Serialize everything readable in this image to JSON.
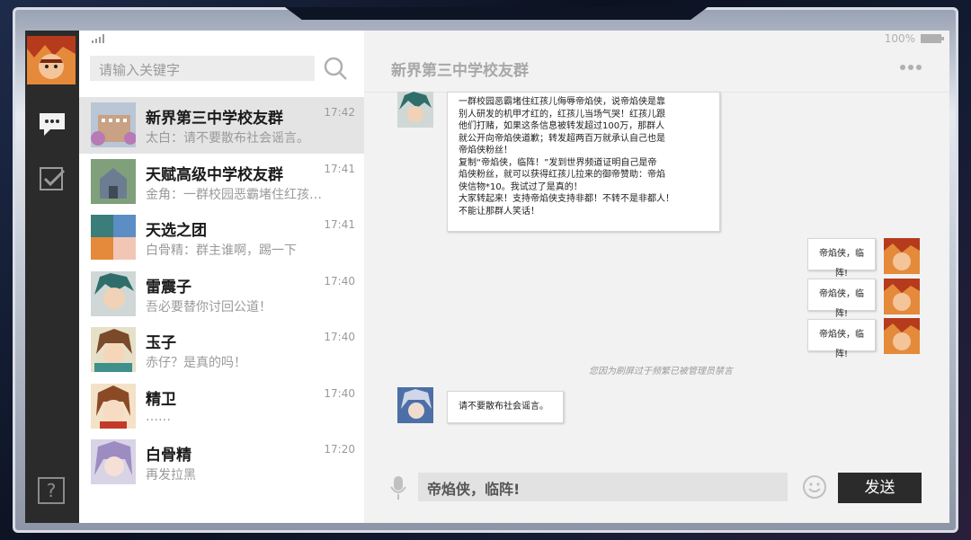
{
  "header": {
    "battery_text": "100%",
    "group_title": "新界第三中学校友群"
  },
  "search": {
    "placeholder": "请输入关键字"
  },
  "contacts": [
    {
      "name": "新界第三中学校友群",
      "time": "17:42",
      "preview": "太白：请不要散布社会谣言。",
      "active": true
    },
    {
      "name": "天赋高级中学校友群",
      "time": "17:41",
      "preview": "金角：一群校园恶霸堵住红孩…"
    },
    {
      "name": "天选之团",
      "time": "17:41",
      "preview": "白骨精：群主谁啊，踢一下"
    },
    {
      "name": "雷震子",
      "time": "17:40",
      "preview": "吾必要替你讨回公道！"
    },
    {
      "name": "玉子",
      "time": "17:40",
      "preview": "赤仔？是真的吗！"
    },
    {
      "name": "精卫",
      "time": "17:40",
      "preview": "……"
    },
    {
      "name": "白骨精",
      "time": "17:20",
      "preview": "再发拉黑"
    }
  ],
  "messages": {
    "long_lines": [
      "一群校园恶霸堵住红孩儿侮辱帝焰侠，说帝焰侠是靠",
      "别人研发的机甲才红的，红孩儿当场气哭！红孩儿跟",
      "他们打赌，如果这条信息被转发超过100万，那群人",
      "就公开向帝焰侠道歉；转发超两百万就承认自己也是",
      "帝焰侠粉丝！",
      "复制“帝焰侠，临阵！”发到世界频道证明自己是帝",
      "焰侠粉丝，就可以获得红孩儿拉来的御帝赞助：帝焰",
      "侠信物*10。我试过了是真的！",
      "大家转起来！支持帝焰侠支持非都！不转不是非都人！",
      "不能让那群人笑话！"
    ],
    "mine": [
      "帝焰侠，临阵!",
      "帝焰侠，临阵!",
      "帝焰侠，临阵!"
    ],
    "system_note": "您因为刷屏过于频繁已被管理员禁言",
    "last": "请不要散布社会谣言。"
  },
  "composer": {
    "input_value": "帝焰侠，临阵!",
    "send_label": "发送"
  },
  "rail": {
    "help_label": "?"
  },
  "colors": {
    "rail_bg": "#2b2b2b",
    "send_bg": "#2b2b2b",
    "active_row": "#e4e4e4",
    "avatar_orange": "#d9742a",
    "avatar_teal": "#3a7d7a",
    "avatar_blue": "#4d6fa8"
  }
}
